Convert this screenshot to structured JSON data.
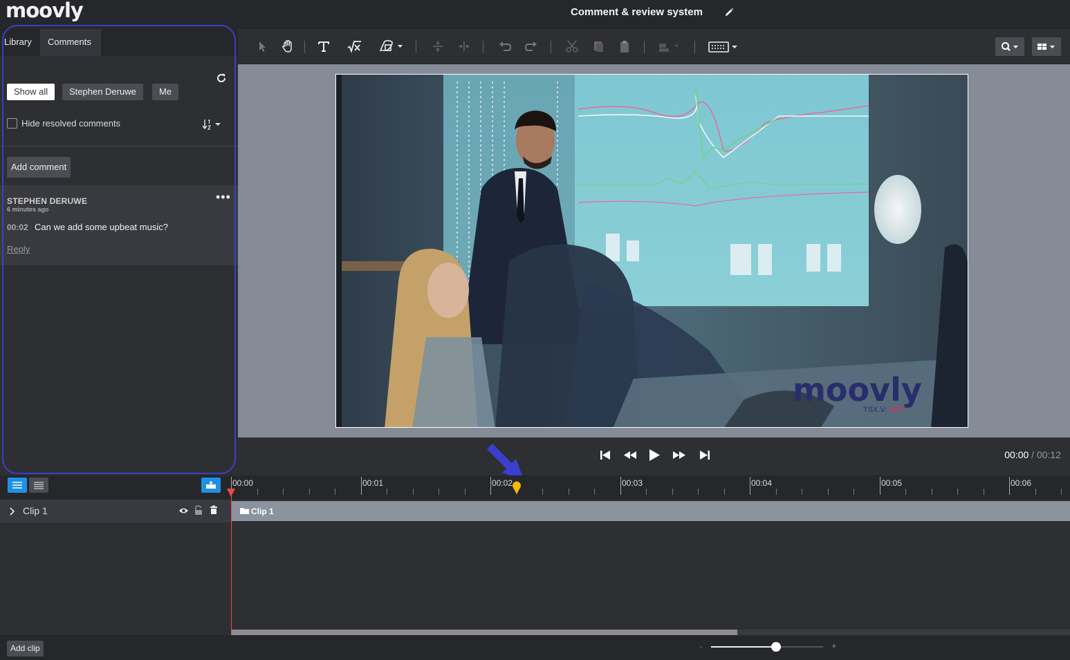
{
  "app": {
    "logo": "moovly",
    "title": "Comment & review system"
  },
  "left_panel": {
    "tabs": [
      {
        "label": "Library"
      },
      {
        "label": "Comments"
      }
    ],
    "filters": [
      {
        "label": "Show all",
        "active": true
      },
      {
        "label": "Stephen Deruwe"
      },
      {
        "label": "Me"
      }
    ],
    "hide_resolved_label": "Hide resolved comments",
    "add_comment_label": "Add comment",
    "comments": [
      {
        "author": "STEPHEN DERUWE",
        "time_ago": "6 minutes ago",
        "timestamp": "00:02",
        "text": "Can we add some upbeat music?",
        "reply_label": "Reply"
      }
    ]
  },
  "toolbar": {
    "icons": [
      "select-arrow-icon",
      "hand-pan-icon",
      "text-icon",
      "formula-icon",
      "shape-icon",
      "align-vertical-icon",
      "align-horizontal-icon",
      "undo-icon",
      "redo-icon",
      "cut-icon",
      "copy-icon",
      "paste-icon",
      "arrange-icon",
      "keyboard-icon",
      "search-icon",
      "layout-grid-icon"
    ]
  },
  "video": {
    "watermark_brand": "moovly",
    "watermark_ticker_prefix": "TSX.V:",
    "watermark_ticker_symbol": "MVY"
  },
  "player": {
    "current_time": "00:00",
    "separator": "/",
    "total_time": "00:12"
  },
  "timeline": {
    "ticks": [
      "00:00",
      "00:01",
      "00:02",
      "00:03",
      "00:04",
      "00:05",
      "00:06"
    ],
    "comment_marker_time": "00:02",
    "tracks": [
      {
        "name": "Clip 1",
        "clip_label": "Clip 1"
      }
    ],
    "add_clip_label": "Add clip",
    "zoom": {
      "minus": "-",
      "plus": "+",
      "level": 0.58
    }
  },
  "colors": {
    "accent_blue": "#1e90e6",
    "highlight_outline": "#3b3fc4",
    "arrow": "#3a3fd0",
    "marker": "#f5b800",
    "playhead": "#e34d4d"
  }
}
